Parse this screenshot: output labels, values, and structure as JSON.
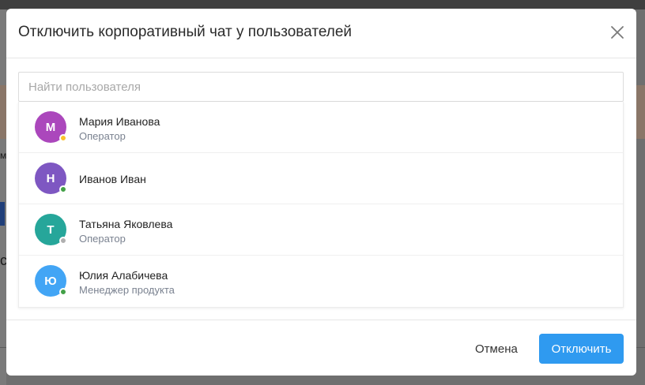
{
  "background": {
    "fragment_m": "м",
    "fragment_c": "с"
  },
  "modal": {
    "title": "Отключить корпоративный чат у пользователей",
    "close_icon": "close-icon",
    "search": {
      "placeholder": "Найти пользователя",
      "value": ""
    },
    "users": [
      {
        "initial": "М",
        "name": "Мария Иванова",
        "role": "Оператор",
        "avatar_color": "#ab47bc",
        "status_color": "#fbc02d"
      },
      {
        "initial": "Н",
        "name": "Иванов Иван",
        "role": "",
        "avatar_color": "#7e57c2",
        "status_color": "#43a047"
      },
      {
        "initial": "Т",
        "name": "Татьяна Яковлева",
        "role": "Оператор",
        "avatar_color": "#26a69a",
        "status_color": "#b0b0b0"
      },
      {
        "initial": "Ю",
        "name": "Юлия Алабичева",
        "role": "Менеджер продукта",
        "avatar_color": "#42a5f5",
        "status_color": "#43a047"
      }
    ],
    "footer": {
      "cancel_label": "Отмена",
      "disable_label": "Отключить"
    }
  },
  "colors": {
    "primary": "#2f9af0"
  }
}
